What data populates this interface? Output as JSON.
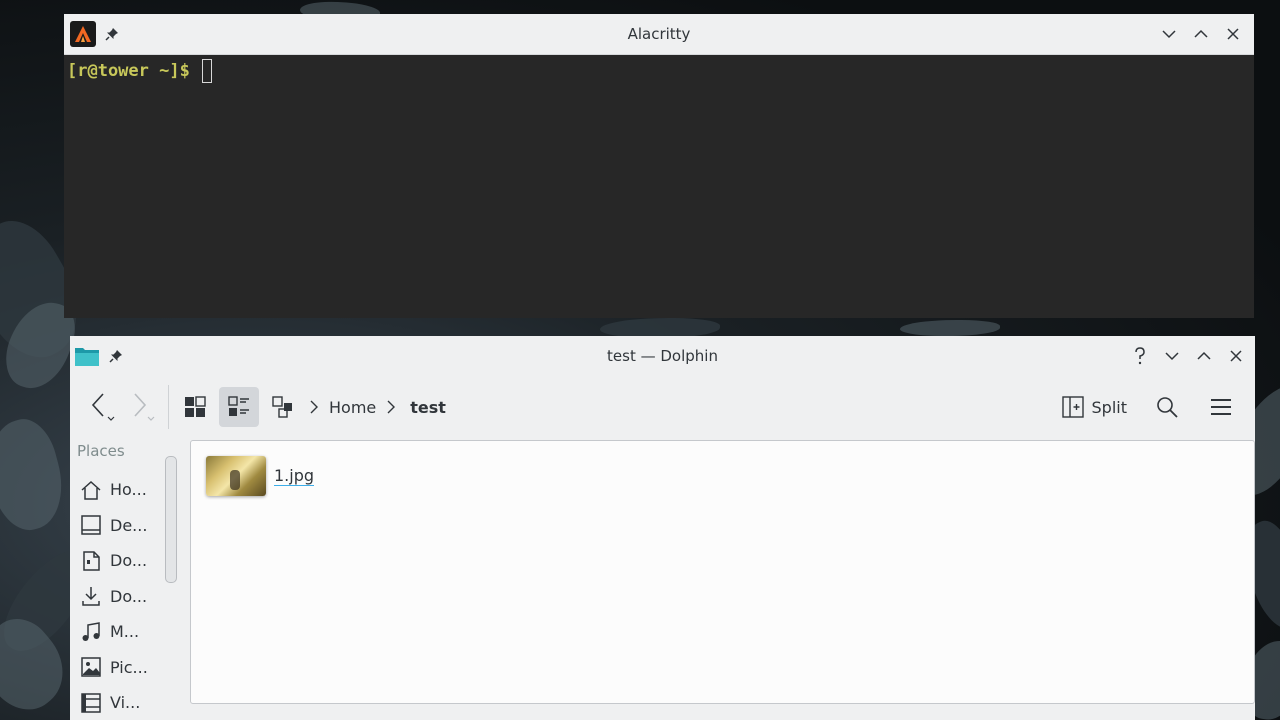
{
  "alacritty": {
    "title": "Alacritty",
    "prompt": "[r@tower ~]$"
  },
  "dolphin": {
    "title": "test — Dolphin",
    "breadcrumb": [
      "Home",
      "test"
    ],
    "split_label": "Split",
    "places_title": "Places",
    "places": [
      {
        "label": "Ho...",
        "icon": "home-icon"
      },
      {
        "label": "De...",
        "icon": "desktop-icon"
      },
      {
        "label": "Do...",
        "icon": "documents-icon"
      },
      {
        "label": "Do...",
        "icon": "downloads-icon"
      },
      {
        "label": "M...",
        "icon": "music-icon"
      },
      {
        "label": "Pic...",
        "icon": "pictures-icon"
      },
      {
        "label": "Vi...",
        "icon": "videos-icon"
      }
    ],
    "files": [
      {
        "name": "1.jpg"
      }
    ]
  },
  "colors": {
    "terminal_bg": "#272727",
    "prompt_color": "#c8c85a",
    "titlebar_bg": "#eff0f1",
    "accent": "#3daee9",
    "folder_teal": "#1d99a8"
  }
}
